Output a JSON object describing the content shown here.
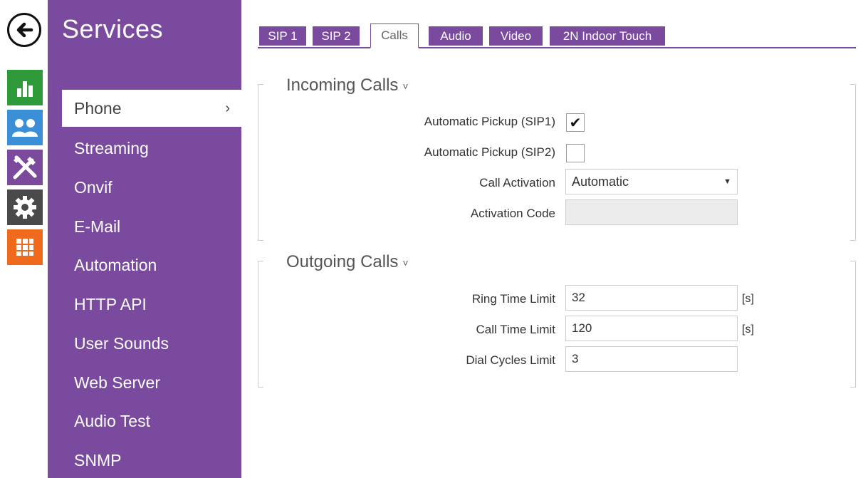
{
  "colors": {
    "accent": "#7a4a9f",
    "status": "#2e9a3a",
    "directory": "#3a8fd6",
    "hardware": "#7b4a9c",
    "system": "#4a4a4a",
    "services": "#f06a1d"
  },
  "rail": {
    "back_icon": "arrow-left-icon",
    "buttons": [
      {
        "icon": "bar-chart-icon"
      },
      {
        "icon": "users-icon"
      },
      {
        "icon": "tools-icon"
      },
      {
        "icon": "gear-icon"
      },
      {
        "icon": "grid-icon"
      }
    ]
  },
  "sidebar": {
    "title": "Services",
    "items": [
      {
        "label": "Phone",
        "chevron": "›"
      },
      {
        "label": "Streaming"
      },
      {
        "label": "Onvif"
      },
      {
        "label": "E-Mail"
      },
      {
        "label": "Automation"
      },
      {
        "label": "HTTP API"
      },
      {
        "label": "User Sounds"
      },
      {
        "label": "Web Server"
      },
      {
        "label": "Audio Test"
      },
      {
        "label": "SNMP"
      }
    ]
  },
  "tabs": [
    {
      "label": "SIP 1"
    },
    {
      "label": "SIP 2"
    },
    {
      "label": "Calls"
    },
    {
      "label": "Audio"
    },
    {
      "label": "Video"
    },
    {
      "label": "2N Indoor Touch"
    }
  ],
  "incoming": {
    "title": "Incoming Calls",
    "caret": "˅",
    "auto_pickup_sip1_label": "Automatic Pickup (SIP1)",
    "auto_pickup_sip1_checked": "✔",
    "auto_pickup_sip2_label": "Automatic Pickup (SIP2)",
    "call_activation_label": "Call Activation",
    "call_activation_value": "Automatic",
    "call_activation_arrow": "▼",
    "activation_code_label": "Activation Code"
  },
  "outgoing": {
    "title": "Outgoing Calls",
    "caret": "˅",
    "ring_time_label": "Ring Time Limit",
    "ring_time_value": "32",
    "ring_time_unit": "[s]",
    "call_time_label": "Call Time Limit",
    "call_time_value": "120",
    "call_time_unit": "[s]",
    "dial_cycles_label": "Dial Cycles Limit",
    "dial_cycles_value": "3"
  }
}
